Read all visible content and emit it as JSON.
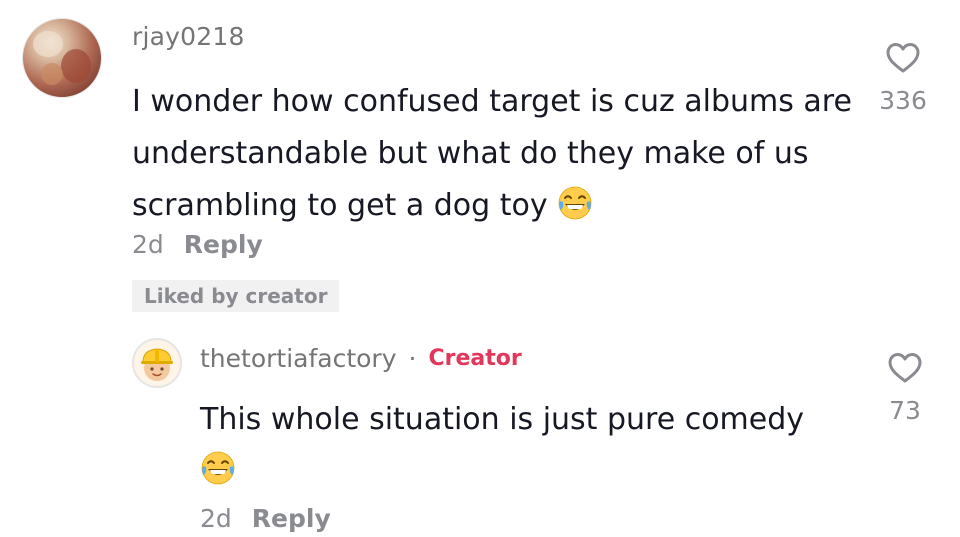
{
  "comment": {
    "username": "rjay0218",
    "text": "I wonder how confused target is cuz albums are understandable but what do they make of us scrambling to get a dog toy",
    "emoji_icon": "face-with-tears-of-joy",
    "time": "2d",
    "reply_label": "Reply",
    "liked_badge": "Liked by creator",
    "like_count": "336"
  },
  "reply": {
    "username": "thetortiafactory",
    "separator": "·",
    "creator_label": "Creator",
    "text": "This whole situation is just pure comedy",
    "emoji_icon": "face-with-tears-of-joy",
    "time": "2d",
    "reply_label": "Reply",
    "like_count": "73"
  },
  "colors": {
    "creator_accent": "#e2365b",
    "secondary_text": "#8a8b91",
    "primary_text": "#161823",
    "badge_bg": "#f1f1f2"
  }
}
